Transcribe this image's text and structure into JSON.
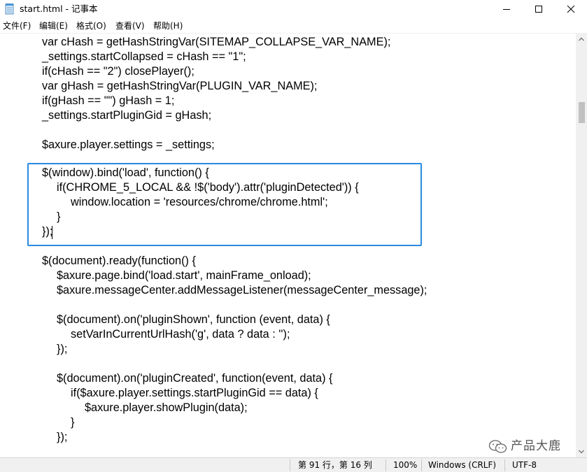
{
  "window": {
    "title": "start.html - 记事本"
  },
  "menu": {
    "file": "文件(F)",
    "edit": "编辑(E)",
    "format": "格式(O)",
    "view": "查看(V)",
    "help": "帮助(H)"
  },
  "editor": {
    "lines": [
      "var cHash = getHashStringVar(SITEMAP_COLLAPSE_VAR_NAME);",
      "_settings.startCollapsed = cHash == \"1\";",
      "if(cHash == \"2\") closePlayer();",
      "var gHash = getHashStringVar(PLUGIN_VAR_NAME);",
      "if(gHash == \"\") gHash = 1;",
      "_settings.startPluginGid = gHash;",
      "",
      "$axure.player.settings = _settings;",
      "",
      "$(window).bind('load', function() {",
      "if(CHROME_5_LOCAL && !$('body').attr('pluginDetected')) {",
      "window.location = 'resources/chrome/chrome.html';",
      "}",
      "});",
      "",
      "$(document).ready(function() {",
      "$axure.page.bind('load.start', mainFrame_onload);",
      "$axure.messageCenter.addMessageListener(messageCenter_message);",
      "",
      "$(document).on('pluginShown', function (event, data) {",
      "setVarInCurrentUrlHash('g', data ? data : '');",
      "});",
      "",
      "$(document).on('pluginCreated', function(event, data) {",
      "if($axure.player.settings.startPluginGid == data) {",
      "$axure.player.showPlugin(data);",
      "}",
      "});"
    ]
  },
  "status": {
    "position": "第 91 行，第 16 列",
    "zoom": "100%",
    "line_ending": "Windows (CRLF)",
    "encoding": "UTF-8"
  },
  "watermark": {
    "text": "产品大鹿"
  },
  "colors": {
    "highlight_border": "#2a8ae0",
    "statusbar_bg": "#f0f0f0"
  }
}
